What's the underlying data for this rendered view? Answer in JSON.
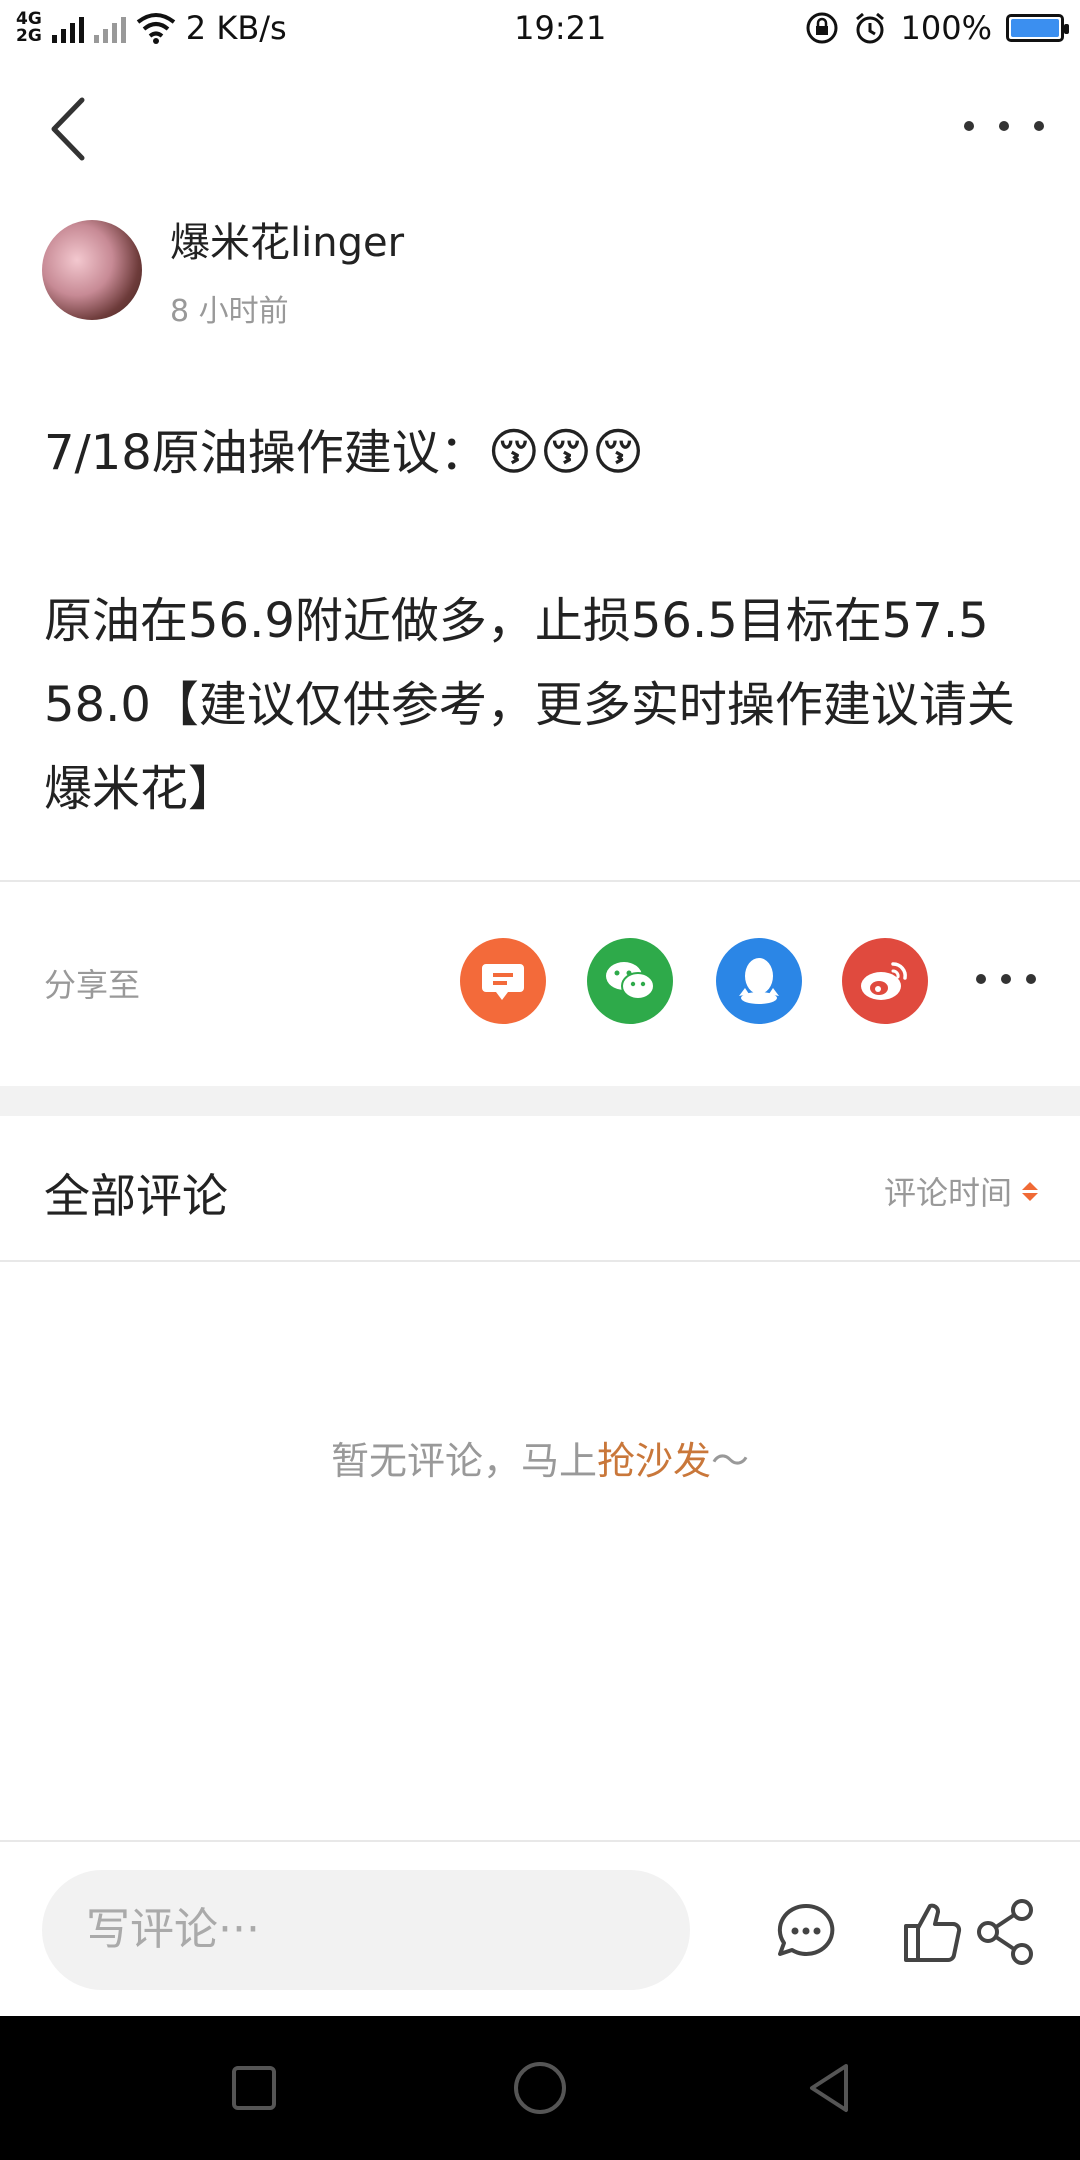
{
  "status_bar": {
    "network": "4G\n2G",
    "speed": "2 KB/s",
    "time": "19:21",
    "battery": "100%",
    "battery_level": 1.0,
    "battery_color": "#3b8ff0"
  },
  "post": {
    "author_name": "爆米花linger",
    "time_ago": "8 小时前",
    "title": "7/18原油操作建议：",
    "title_emoji": "😚😚😚",
    "body": "原油在56.9附近做多，止损56.5目标在57.5 58.0【建议仅供参考，更多实时操作建议请关 爆米花】"
  },
  "share": {
    "label": "分享至",
    "targets": [
      {
        "name": "message-icon",
        "color": "#f36a3a"
      },
      {
        "name": "wechat-icon",
        "color": "#2eaa4a"
      },
      {
        "name": "qq-icon",
        "color": "#2b86e6"
      },
      {
        "name": "weibo-icon",
        "color": "#e04a3e"
      }
    ]
  },
  "comments": {
    "title": "全部评论",
    "sort_label": "评论时间",
    "empty_prefix": "暂无评论，马上",
    "empty_link": "抢沙发",
    "empty_suffix": "～",
    "accent_color": "#f06a35"
  },
  "bottom_bar": {
    "input_placeholder": "写评论···"
  }
}
